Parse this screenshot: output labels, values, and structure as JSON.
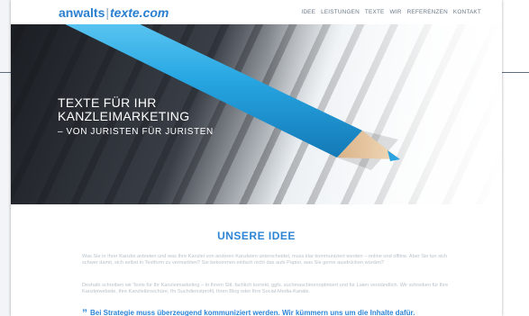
{
  "nav": {
    "logo_part1": "anwalts",
    "logo_sep": "|",
    "logo_part2": "texte.com",
    "menu": [
      "IDEE",
      "LEISTUNGEN",
      "TEXTE",
      "WIR",
      "REFERENZEN",
      "KONTAKT"
    ]
  },
  "hero": {
    "line1": "TEXTE FÜR IHR",
    "line2": "KANZLEIMARKETING",
    "line3": "– VON JURISTEN FÜR JURISTEN"
  },
  "main": {
    "section_title": "UNSERE IDEE",
    "paragraph1": "Was Sie in Ihrer Kanzlei anbieten und was Ihre Kanzlei von anderen Kanzleien unterscheidet, muss klar kommuniziert werden – online und offline. Aber Sie tun sich schwer damit, sich selbst in Textform zu vermarkten? Sie bekommen einfach nicht das aufs Papier, was Sie gerne ausdrücken würden?",
    "paragraph2": "Deshalb schreiben wir Texte für Ihr Kanzleimarketing – in Ihrem Stil, fachlich korrekt, ggfs. suchmaschinenoptimiert und für Laien verständlich. Wir schreiben für Ihre Kanzleiwebsite, Ihre Kanzleibroschüre, Ihr Suchdienstprofil, Ihren Blog oder Ihre Social-Media-Kanäle.",
    "quote_mark": "”",
    "quote_text": "Bei Strategie muss überzeugend kommuniziert werden. Wir kümmern uns um die Inhalte dafür."
  },
  "colors": {
    "accent": "#2d85d6",
    "pencil_blue": "#27a7e3",
    "pencil_wood": "#e7c79e"
  }
}
